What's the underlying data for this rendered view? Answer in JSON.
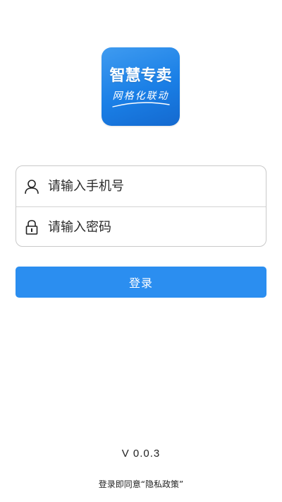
{
  "logo": {
    "title": "智慧专卖",
    "subtitle": "网格化联动",
    "color": "#1a7fe6"
  },
  "form": {
    "phone": {
      "placeholder": "请输入手机号",
      "value": "",
      "icon": "user-icon"
    },
    "password": {
      "placeholder": "请输入密码",
      "value": "",
      "icon": "lock-icon"
    }
  },
  "login_button": {
    "label": "登录",
    "color": "#2b8ef0"
  },
  "footer": {
    "version": "V 0.0.3",
    "policy_prefix": "登录即同意",
    "policy_link": "“隐私政策”"
  }
}
